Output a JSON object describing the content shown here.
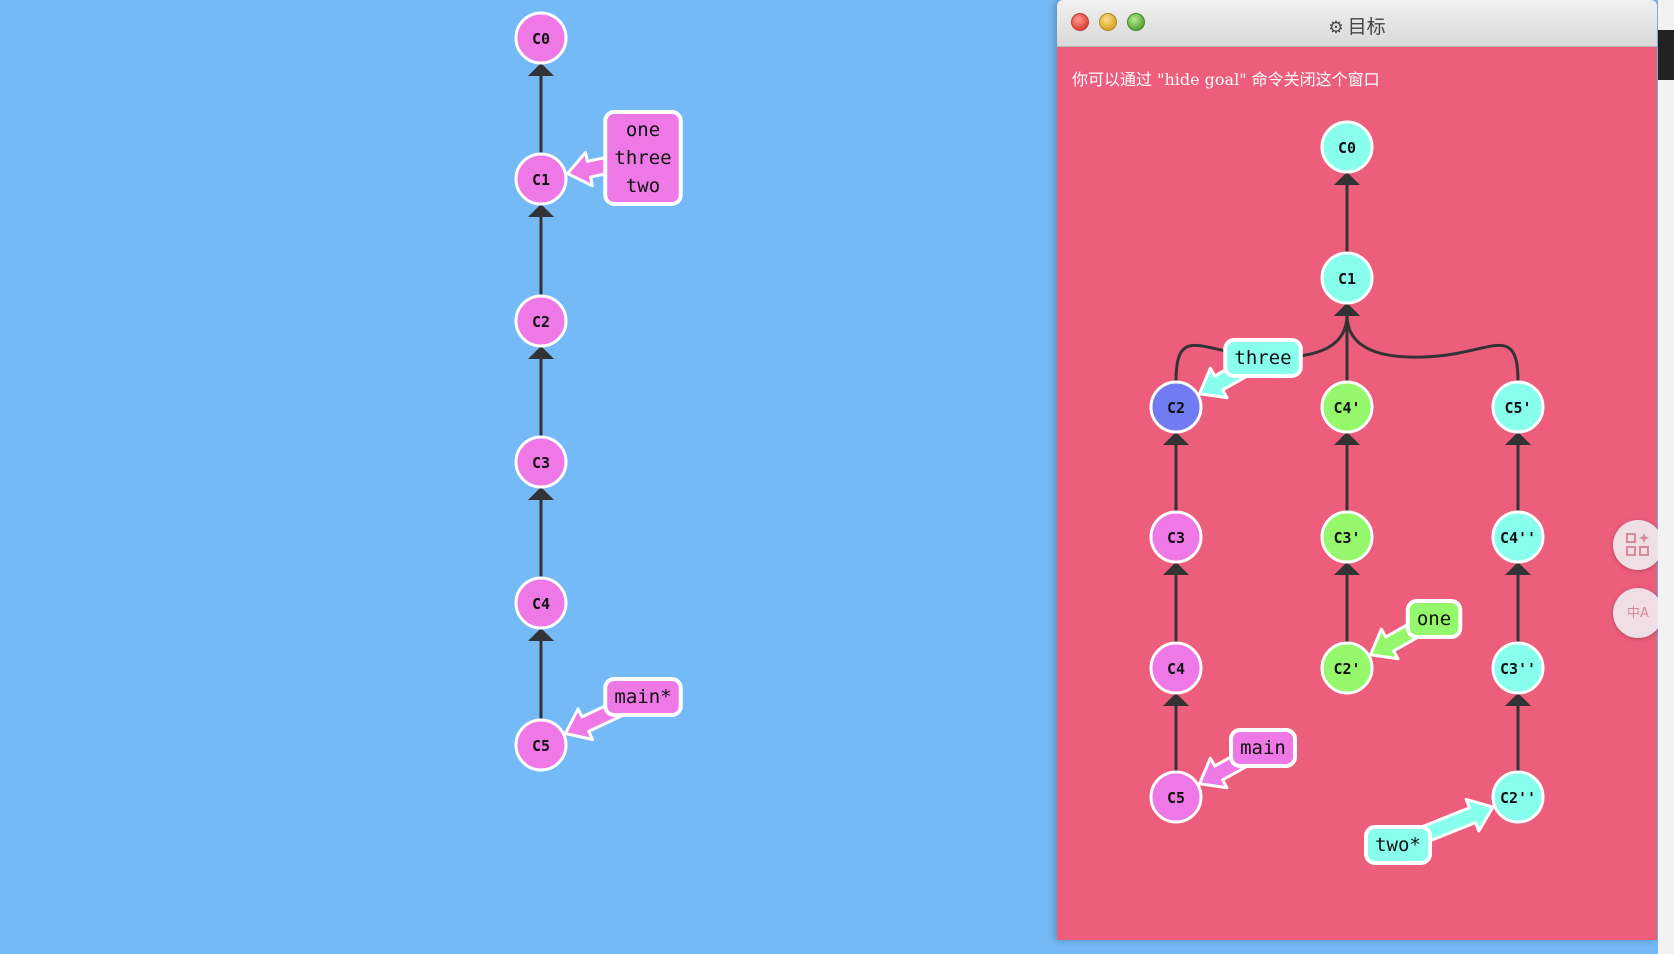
{
  "goal_window": {
    "title": "目标",
    "hint": "你可以通过 \"hide goal\" 命令关闭这个窗口"
  },
  "side_buttons": [
    {
      "icon": "grid-sparkle-icon"
    },
    {
      "icon": "translate-icon",
      "label": "中A"
    }
  ],
  "colors": {
    "background": "#74baf6",
    "goal_background": "#ec5e7c",
    "main_branch": "#ee79e6",
    "aqua": "#87ffec",
    "green": "#95f76b",
    "head": "#717bf2",
    "edge": "#333333"
  },
  "main_graph": {
    "commits": [
      {
        "id": "C0",
        "label": "C0",
        "color": "#ee79e6"
      },
      {
        "id": "C1",
        "label": "C1",
        "color": "#ee79e6"
      },
      {
        "id": "C2",
        "label": "C2",
        "color": "#ee79e6"
      },
      {
        "id": "C3",
        "label": "C3",
        "color": "#ee79e6"
      },
      {
        "id": "C4",
        "label": "C4",
        "color": "#ee79e6"
      },
      {
        "id": "C5",
        "label": "C5",
        "color": "#ee79e6"
      }
    ],
    "edges": [
      [
        "C1",
        "C0"
      ],
      [
        "C2",
        "C1"
      ],
      [
        "C3",
        "C2"
      ],
      [
        "C4",
        "C3"
      ],
      [
        "C5",
        "C4"
      ]
    ],
    "branches": [
      {
        "names": [
          "one",
          "three",
          "two"
        ],
        "target": "C1",
        "color": "#ee79e6"
      },
      {
        "names": [
          "main*"
        ],
        "target": "C5",
        "color": "#ee79e6"
      }
    ]
  },
  "goal_graph": {
    "commits": [
      {
        "id": "g-C0",
        "label": "C0",
        "color": "#87ffec"
      },
      {
        "id": "g-C1",
        "label": "C1",
        "color": "#87ffec"
      },
      {
        "id": "g-C2",
        "label": "C2",
        "color": "#717bf2"
      },
      {
        "id": "g-C3",
        "label": "C3",
        "color": "#ee79e6"
      },
      {
        "id": "g-C4",
        "label": "C4",
        "color": "#ee79e6"
      },
      {
        "id": "g-C5",
        "label": "C5",
        "color": "#ee79e6"
      },
      {
        "id": "g-C4p",
        "label": "C4'",
        "color": "#95f76b"
      },
      {
        "id": "g-C3p",
        "label": "C3'",
        "color": "#95f76b"
      },
      {
        "id": "g-C2p",
        "label": "C2'",
        "color": "#95f76b"
      },
      {
        "id": "g-C5p",
        "label": "C5'",
        "color": "#87ffec"
      },
      {
        "id": "g-C4pp",
        "label": "C4''",
        "color": "#87ffec"
      },
      {
        "id": "g-C3pp",
        "label": "C3''",
        "color": "#87ffec"
      },
      {
        "id": "g-C2pp",
        "label": "C2''",
        "color": "#87ffec"
      }
    ],
    "edges": [
      [
        "g-C1",
        "g-C0"
      ],
      [
        "g-C2",
        "g-C1"
      ],
      [
        "g-C4p",
        "g-C1"
      ],
      [
        "g-C5p",
        "g-C1"
      ],
      [
        "g-C3",
        "g-C2"
      ],
      [
        "g-C4",
        "g-C3"
      ],
      [
        "g-C5",
        "g-C4"
      ],
      [
        "g-C3p",
        "g-C4p"
      ],
      [
        "g-C2p",
        "g-C3p"
      ],
      [
        "g-C4pp",
        "g-C5p"
      ],
      [
        "g-C3pp",
        "g-C4pp"
      ],
      [
        "g-C2pp",
        "g-C3pp"
      ]
    ],
    "branches": [
      {
        "names": [
          "three"
        ],
        "target": "g-C2",
        "color": "#87ffec"
      },
      {
        "names": [
          "one"
        ],
        "target": "g-C2p",
        "color": "#95f76b"
      },
      {
        "names": [
          "main"
        ],
        "target": "g-C5",
        "color": "#ee79e6"
      },
      {
        "names": [
          "two*"
        ],
        "target": "g-C2pp",
        "color": "#87ffec"
      }
    ]
  }
}
